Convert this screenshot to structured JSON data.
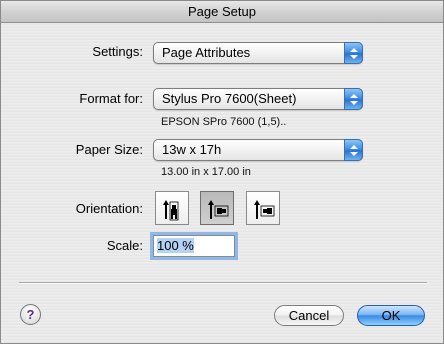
{
  "window": {
    "title": "Page Setup"
  },
  "settings": {
    "label": "Settings:",
    "value": "Page Attributes"
  },
  "format": {
    "label": "Format for:",
    "value": "Stylus Pro 7600(Sheet)",
    "subtext": "EPSON SPro 7600 (1,5).."
  },
  "paper": {
    "label": "Paper Size:",
    "value": "13w x 17h",
    "subtext": "13.00 in x 17.00 in"
  },
  "orientation": {
    "label": "Orientation:",
    "options": [
      {
        "icon": "portrait-icon",
        "selected": false
      },
      {
        "icon": "landscape-left-icon",
        "selected": true
      },
      {
        "icon": "landscape-right-icon",
        "selected": false
      }
    ]
  },
  "scale": {
    "label": "Scale:",
    "value": "100 %"
  },
  "buttons": {
    "help": "?",
    "cancel": "Cancel",
    "ok": "OK"
  },
  "colors": {
    "accent": "#3a8ae6",
    "selection": "#b4d2f4"
  }
}
